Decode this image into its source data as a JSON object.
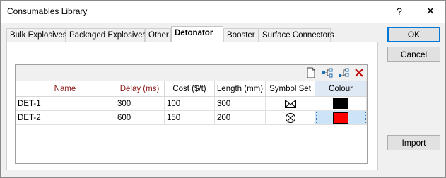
{
  "window": {
    "title": "Consumables Library",
    "help_label": "?",
    "close_label": "✕"
  },
  "tabs": [
    {
      "label": "Bulk Explosives"
    },
    {
      "label": "Packaged Explosives"
    },
    {
      "label": "Other"
    },
    {
      "label": "Detonator"
    },
    {
      "label": "Booster"
    },
    {
      "label": "Surface Connectors"
    }
  ],
  "active_tab": "Detonator",
  "grid": {
    "toolbar": [
      "new-icon",
      "tree-icon",
      "insert-icon",
      "delete-icon"
    ],
    "columns": [
      "Name",
      "Delay (ms)",
      "Cost ($/t)",
      "Length (mm)",
      "Symbol Set",
      "Colour"
    ],
    "rows": [
      {
        "name": "DET-1",
        "delay": "300",
        "cost": "100",
        "length": "300",
        "symbol": "envelope-symbol",
        "colour": "#000000"
      },
      {
        "name": "DET-2",
        "delay": "600",
        "cost": "150",
        "length": "200",
        "symbol": "circle-x-symbol",
        "colour": "#ff0000"
      }
    ]
  },
  "buttons": {
    "ok": "OK",
    "cancel": "Cancel",
    "import": "Import"
  },
  "colors": {
    "header_red": "#8b1a1a",
    "selection": "#cce4f7",
    "delete_icon": "#c00000"
  }
}
